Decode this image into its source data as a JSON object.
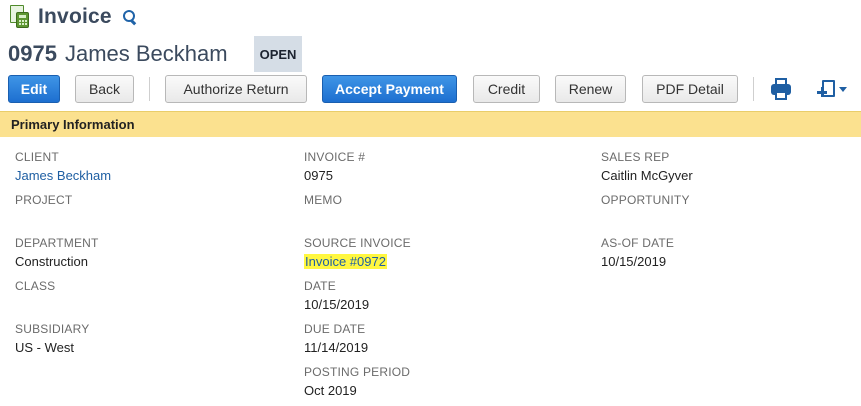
{
  "header": {
    "title": "Invoice",
    "record_number": "0975",
    "record_name": "James Beckham",
    "status": "OPEN"
  },
  "icons": {
    "record": "invoice-calculator-icon",
    "search": "search-icon",
    "print": "printer-icon",
    "new_document": "new-document-icon"
  },
  "colors": {
    "primary_button": "#1d6fd0",
    "section_header": "#fbe18f",
    "link": "#1f5fa3",
    "highlight": "#fff740"
  },
  "toolbar": {
    "edit": "Edit",
    "back": "Back",
    "authorize_return": "Authorize Return",
    "accept_payment": "Accept Payment",
    "credit": "Credit",
    "renew": "Renew",
    "pdf_detail": "PDF Detail"
  },
  "section": {
    "title": "Primary Information"
  },
  "fields": {
    "client": {
      "label": "CLIENT",
      "value": "James Beckham"
    },
    "project": {
      "label": "PROJECT",
      "value": ""
    },
    "department": {
      "label": "DEPARTMENT",
      "value": "Construction"
    },
    "class": {
      "label": "CLASS",
      "value": ""
    },
    "subsidiary": {
      "label": "SUBSIDIARY",
      "value": "US - West"
    },
    "invoice_number": {
      "label": "INVOICE #",
      "value": "0975"
    },
    "memo": {
      "label": "MEMO",
      "value": ""
    },
    "source_invoice": {
      "label": "SOURCE INVOICE",
      "value": "Invoice #0972"
    },
    "date": {
      "label": "DATE",
      "value": "10/15/2019"
    },
    "due_date": {
      "label": "DUE DATE",
      "value": "11/14/2019"
    },
    "posting_period": {
      "label": "POSTING PERIOD",
      "value": "Oct 2019"
    },
    "sales_rep": {
      "label": "SALES REP",
      "value": "Caitlin McGyver"
    },
    "opportunity": {
      "label": "OPPORTUNITY",
      "value": ""
    },
    "as_of_date": {
      "label": "AS-OF DATE",
      "value": "10/15/2019"
    }
  }
}
